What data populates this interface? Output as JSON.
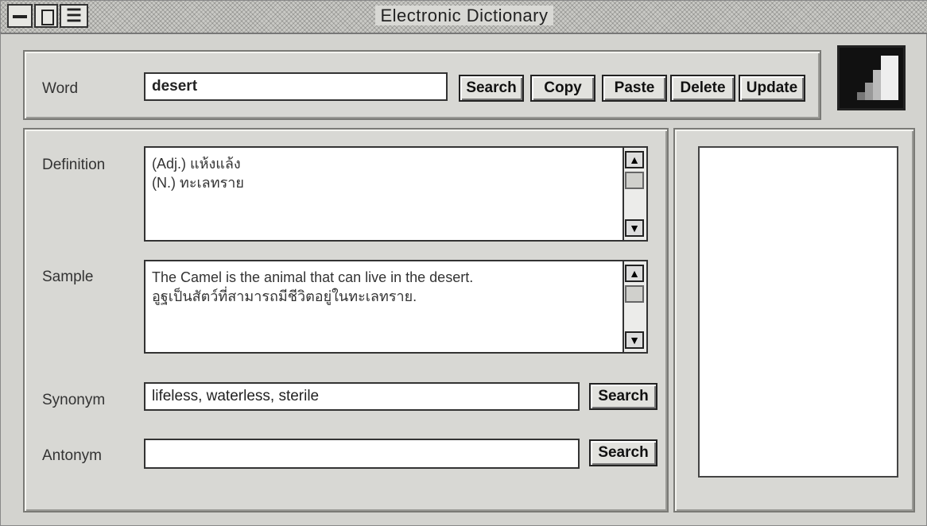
{
  "window": {
    "title": "Electronic Dictionary",
    "sys_list_glyph": "☰"
  },
  "word": {
    "label": "Word",
    "value": "desert"
  },
  "toolbar": {
    "search_label": "Search",
    "copy_label": "Copy",
    "paste_label": "Paste",
    "delete_label": "Delete",
    "update_label": "Update"
  },
  "definition": {
    "label": "Definition",
    "text": "(Adj.) แห้งแล้ง\n(N.) ทะเลทราย"
  },
  "sample": {
    "label": "Sample",
    "text": "The Camel is the animal that can live in the desert.\nอูฐเป็นสัตว์ที่สามารถมีชีวิตอยู่ในทะเลทราย."
  },
  "synonym": {
    "label": "Synonym",
    "value": "lifeless, waterless, sterile",
    "search_label": "Search"
  },
  "antonym": {
    "label": "Antonym",
    "value": "",
    "search_label": "Search"
  },
  "scrollbar": {
    "up_glyph": "▲",
    "down_glyph": "▼"
  }
}
